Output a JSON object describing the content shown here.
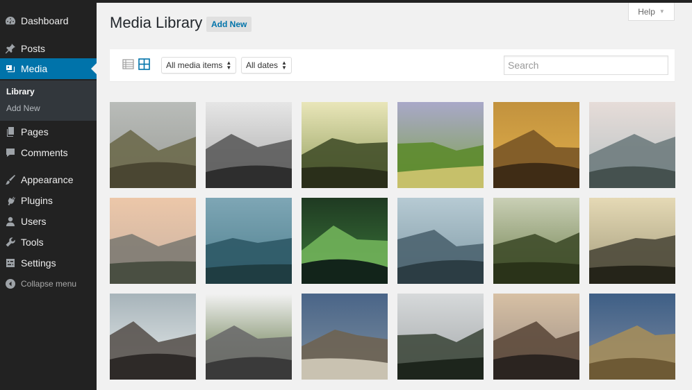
{
  "sidebar": {
    "items": [
      {
        "label": "Dashboard",
        "icon": "dashboard-icon"
      },
      {
        "label": "Posts",
        "icon": "pin-icon"
      },
      {
        "label": "Media",
        "icon": "media-icon"
      },
      {
        "label": "Pages",
        "icon": "pages-icon"
      },
      {
        "label": "Comments",
        "icon": "comment-icon"
      },
      {
        "label": "Appearance",
        "icon": "brush-icon"
      },
      {
        "label": "Plugins",
        "icon": "plugin-icon"
      },
      {
        "label": "Users",
        "icon": "user-icon"
      },
      {
        "label": "Tools",
        "icon": "wrench-icon"
      },
      {
        "label": "Settings",
        "icon": "settings-icon"
      }
    ],
    "submenu": {
      "library": "Library",
      "add_new": "Add New"
    },
    "collapse": "Collapse menu",
    "active_color": "#0073aa"
  },
  "help": {
    "label": "Help"
  },
  "page": {
    "title": "Media Library",
    "add_new": "Add New"
  },
  "toolbar": {
    "filter_type": "All media items",
    "filter_date": "All dates",
    "search_placeholder": "Search",
    "view_mode": "grid"
  },
  "media": [
    {
      "kind": "meadow-fog",
      "colors": [
        "#b9bcb9",
        "#9a9c96",
        "#6d6a4c",
        "#4a4632"
      ]
    },
    {
      "kind": "bw-mountains",
      "colors": [
        "#e6e6e6",
        "#a9a9a9",
        "#5c5c5c",
        "#2e2e2e"
      ]
    },
    {
      "kind": "forest-sun",
      "colors": [
        "#e9e6b9",
        "#8f9b5a",
        "#44502a",
        "#2a2f1a"
      ]
    },
    {
      "kind": "green-hills",
      "colors": [
        "#a9a8c9",
        "#7da24a",
        "#5d8b2e",
        "#c6c06a"
      ]
    },
    {
      "kind": "cactus-orange",
      "colors": [
        "#c2923e",
        "#e2b04a",
        "#7a5626",
        "#3f2c15"
      ]
    },
    {
      "kind": "snow-trees",
      "colors": [
        "#e6dcd8",
        "#b8c2c4",
        "#6f7c7e",
        "#45514f"
      ]
    },
    {
      "kind": "cliff-dawn",
      "colors": [
        "#ecc7a9",
        "#c9b2a2",
        "#7e7b73",
        "#4a4f42"
      ]
    },
    {
      "kind": "lake-teal",
      "colors": [
        "#7ea6b5",
        "#4e7f8e",
        "#2d5966",
        "#1f3d42"
      ]
    },
    {
      "kind": "succulent",
      "colors": [
        "#1f3a22",
        "#3c7a3a",
        "#71b35a",
        "#12241a"
      ]
    },
    {
      "kind": "lake-mist",
      "colors": [
        "#b6cad3",
        "#7e98a4",
        "#4c6470",
        "#2c3d44"
      ]
    },
    {
      "kind": "cabin-hills",
      "colors": [
        "#c9cfb5",
        "#6e7f4d",
        "#3f4d2a",
        "#2a3319"
      ]
    },
    {
      "kind": "valley-sunset",
      "colors": [
        "#e5d9b5",
        "#a19a7a",
        "#4e4a3b",
        "#252419"
      ]
    },
    {
      "kind": "waves-rock",
      "colors": [
        "#a7b4ba",
        "#e8ecec",
        "#5a5450",
        "#2e2a28"
      ]
    },
    {
      "kind": "snowy-peak",
      "colors": [
        "#f2f2f2",
        "#556b38",
        "#6b6b6b",
        "#3a3a3a"
      ]
    },
    {
      "kind": "road-plain",
      "colors": [
        "#4a6588",
        "#7d8f9f",
        "#6e6352",
        "#c9c2b1"
      ]
    },
    {
      "kind": "pine-fog",
      "colors": [
        "#d6d9da",
        "#a2a6a8",
        "#404a3e",
        "#1d251c"
      ]
    },
    {
      "kind": "coast-rock",
      "colors": [
        "#d7c0a4",
        "#9b8e85",
        "#5d4a3c",
        "#2b2420"
      ]
    },
    {
      "kind": "dune-sky",
      "colors": [
        "#3e5f86",
        "#7d8aa0",
        "#a48d5b",
        "#6e5a35"
      ]
    }
  ]
}
